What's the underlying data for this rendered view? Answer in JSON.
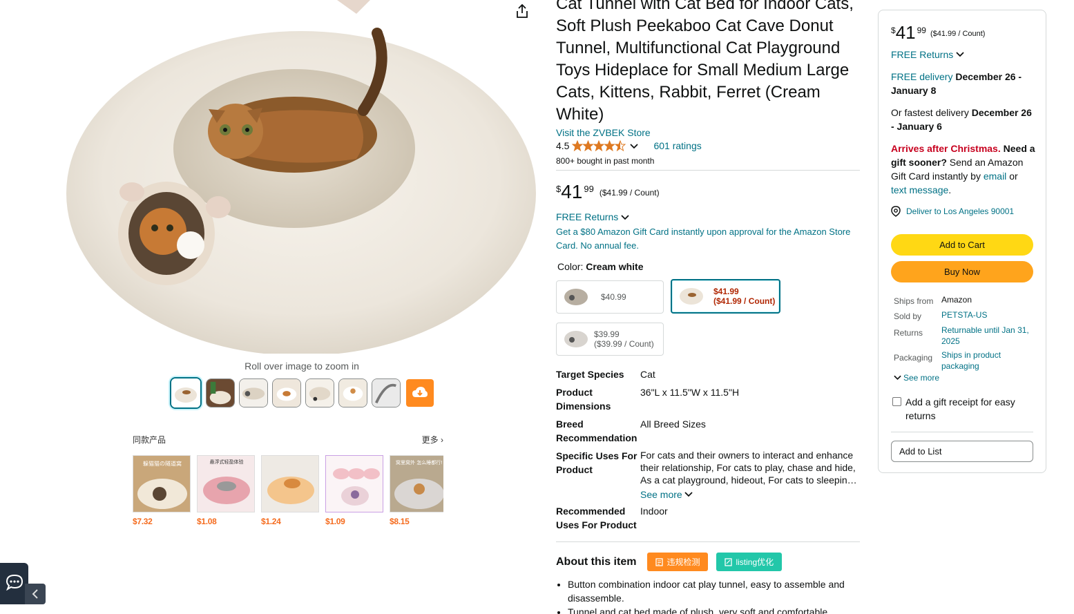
{
  "gallery": {
    "zoom_hint": "Roll over image to zoom in",
    "share_icon": "share-icon",
    "thumbnails": [
      "thumb-1",
      "thumb-2",
      "thumb-3",
      "thumb-4",
      "thumb-5",
      "thumb-6",
      "thumb-7"
    ],
    "download_icon": "cloud-download-icon"
  },
  "similar": {
    "heading": "同款产品",
    "more": "更多",
    "items": [
      {
        "price": "$7.32",
        "caption": "躲猫猫の隧道窝"
      },
      {
        "price": "$1.08",
        "caption": "悬浮式轻盈体验"
      },
      {
        "price": "$1.24",
        "caption": ""
      },
      {
        "price": "$1.09",
        "caption": ""
      },
      {
        "price": "$8.15",
        "caption": "窝里窝外 怎么睡都行!"
      }
    ]
  },
  "product": {
    "title": "Cat Tunnel with Cat Bed for Indoor Cats, Soft Plush Peekaboo Cat Cave Donut Tunnel, Multifunctional Cat Playground Toys Hideplace for Small Medium Large Cats, Kittens, Rabbit, Ferret (Cream White)",
    "store_link": "Visit the ZVBEK Store",
    "rating": "4.5",
    "ratings_count": "601 ratings",
    "bought": "800+ bought in past month",
    "price_symbol": "$",
    "price_whole": "41",
    "price_fraction": "99",
    "price_unit": "($41.99 / Count)",
    "free_returns": "FREE Returns",
    "giftcard_offer": "Get a $80 Amazon Gift Card instantly upon approval for the Amazon Store Card. No annual fee.",
    "color_label": "Color:",
    "color_value": "Cream white",
    "swatches": [
      {
        "price": "$40.99",
        "unit": ""
      },
      {
        "price": "$41.99",
        "unit": "($41.99 / Count)"
      },
      {
        "price": "$39.99",
        "unit": "($39.99 / Count)"
      }
    ],
    "specs": [
      {
        "key": "Target Species",
        "value": "Cat"
      },
      {
        "key": "Product Dimensions",
        "value": "36\"L x 11.5\"W x 11.5\"H"
      },
      {
        "key": "Breed Recommendation",
        "value": "All Breed Sizes"
      },
      {
        "key": "Specific Uses For Product",
        "value": "For cats and their owners to interact and enhance their relationship, For cats to play, chase and hide, As a cat playground, hideout, For cats to sleepin…"
      },
      {
        "key": "Recommended Uses For Product",
        "value": "Indoor"
      }
    ],
    "see_more": "See more",
    "about_title": "About this item",
    "tag_violation": "违规检测",
    "tag_listing": "listing优化",
    "bullets": [
      "Button combination indoor cat play tunnel, easy to assemble and disassemble.",
      "Tunnel and cat bed made of plush, very soft and comfortable."
    ]
  },
  "buybox": {
    "price_symbol": "$",
    "price_whole": "41",
    "price_fraction": "99",
    "price_unit": "($41.99 / Count)",
    "free_returns": "FREE Returns",
    "free_delivery_prefix": "FREE delivery",
    "free_delivery_dates": "December 26 - January 8",
    "fastest_prefix": "Or fastest delivery",
    "fastest_dates": "December 26 - January 6",
    "xmas_red": "Arrives after Christmas.",
    "xmas_bold": "Need a gift sooner?",
    "xmas_text": "Send an Amazon Gift Card instantly by",
    "xmas_email": "email",
    "xmas_or": "or",
    "xmas_text_msg": "text message",
    "xmas_end": ".",
    "deliver_to": "Deliver to Los Angeles 90001",
    "add_to_cart": "Add to Cart",
    "buy_now": "Buy Now",
    "ships_from_label": "Ships from",
    "ships_from_value": "Amazon",
    "sold_by_label": "Sold by",
    "sold_by_value": "PETSTA-US",
    "returns_label": "Returns",
    "returns_value": "Returnable until Jan 31, 2025",
    "packaging_label": "Packaging",
    "packaging_value": "Ships in product packaging",
    "see_more": "See more",
    "gift_receipt": "Add a gift receipt for easy returns",
    "add_to_list": "Add to List"
  },
  "colors": {
    "link": "#007185",
    "cart": "#ffd814",
    "buy": "#ffa41c",
    "price_red": "#b12704",
    "star": "#de7921",
    "tag_orange": "#ff8a1f",
    "tag_teal": "#22c7a9"
  }
}
